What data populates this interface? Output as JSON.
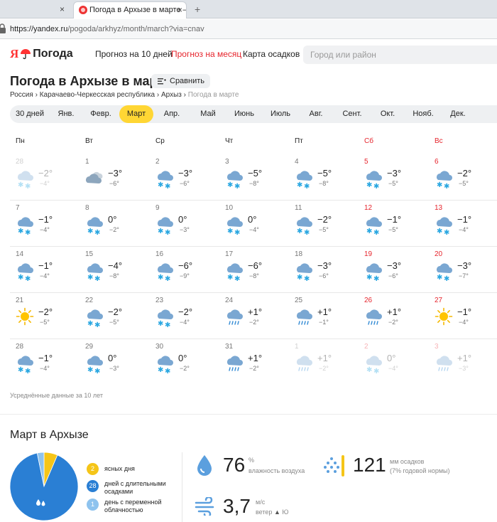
{
  "browser": {
    "tab_inactive_label": "",
    "tab_active_label": "Погода в Архызе в марте — Янд",
    "close_glyph": "×",
    "newtab_glyph": "+",
    "url_host": "https://yandex.ru",
    "url_path": "/pogoda/arkhyz/month/march?via=cnav"
  },
  "header": {
    "logo_ya": "Я",
    "logo_brand": "Погода",
    "nav": [
      "Прогноз на 10 дней",
      "Прогноз на месяц",
      "Карта осадков"
    ],
    "search_placeholder": "Город или район"
  },
  "page": {
    "title": "Погода в Архызе в марте",
    "compare_label": "Сравнить",
    "breadcrumbs": [
      "Россия",
      "Карачаево-Черкесская республика",
      "Архыз",
      "Погода в марте"
    ],
    "crumb_sep": " › "
  },
  "months": [
    "30 дней",
    "Янв.",
    "Февр.",
    "Март",
    "Апр.",
    "Май",
    "Июнь",
    "Июль",
    "Авг.",
    "Сент.",
    "Окт.",
    "Нояб.",
    "Дек."
  ],
  "active_month": 3,
  "weekdays": [
    "Пн",
    "Вт",
    "Ср",
    "Чт",
    "Пт",
    "Сб",
    "Вс"
  ],
  "calendar": [
    [
      {
        "day": "28",
        "icon": "snow",
        "tmax": "−2°",
        "tmin": "−4°",
        "faded": true
      },
      {
        "day": "1",
        "icon": "cloudy",
        "tmax": "−3°",
        "tmin": "−6°"
      },
      {
        "day": "2",
        "icon": "snow",
        "tmax": "−3°",
        "tmin": "−6°"
      },
      {
        "day": "3",
        "icon": "snow",
        "tmax": "−5°",
        "tmin": "−8°"
      },
      {
        "day": "4",
        "icon": "snow",
        "tmax": "−5°",
        "tmin": "−8°"
      },
      {
        "day": "5",
        "icon": "snow",
        "tmax": "−3°",
        "tmin": "−5°"
      },
      {
        "day": "6",
        "icon": "snow",
        "tmax": "−2°",
        "tmin": "−5°"
      }
    ],
    [
      {
        "day": "7",
        "icon": "snow",
        "tmax": "−1°",
        "tmin": "−4°"
      },
      {
        "day": "8",
        "icon": "snow",
        "tmax": "0°",
        "tmin": "−2°"
      },
      {
        "day": "9",
        "icon": "snow",
        "tmax": "0°",
        "tmin": "−3°"
      },
      {
        "day": "10",
        "icon": "snow",
        "tmax": "0°",
        "tmin": "−4°"
      },
      {
        "day": "11",
        "icon": "snow",
        "tmax": "−2°",
        "tmin": "−5°"
      },
      {
        "day": "12",
        "icon": "snow",
        "tmax": "−1°",
        "tmin": "−5°"
      },
      {
        "day": "13",
        "icon": "snow",
        "tmax": "−1°",
        "tmin": "−4°"
      }
    ],
    [
      {
        "day": "14",
        "icon": "snow",
        "tmax": "−1°",
        "tmin": "−4°"
      },
      {
        "day": "15",
        "icon": "snow",
        "tmax": "−4°",
        "tmin": "−8°"
      },
      {
        "day": "16",
        "icon": "snow",
        "tmax": "−6°",
        "tmin": "−9°"
      },
      {
        "day": "17",
        "icon": "snow",
        "tmax": "−6°",
        "tmin": "−8°"
      },
      {
        "day": "18",
        "icon": "snow",
        "tmax": "−3°",
        "tmin": "−6°"
      },
      {
        "day": "19",
        "icon": "snow",
        "tmax": "−3°",
        "tmin": "−6°"
      },
      {
        "day": "20",
        "icon": "snow",
        "tmax": "−3°",
        "tmin": "−7°"
      }
    ],
    [
      {
        "day": "21",
        "icon": "sun",
        "tmax": "−2°",
        "tmin": "−5°"
      },
      {
        "day": "22",
        "icon": "snow",
        "tmax": "−2°",
        "tmin": "−5°"
      },
      {
        "day": "23",
        "icon": "snow",
        "tmax": "−2°",
        "tmin": "−4°"
      },
      {
        "day": "24",
        "icon": "rain",
        "tmax": "+1°",
        "tmin": "−2°"
      },
      {
        "day": "25",
        "icon": "rain",
        "tmax": "+1°",
        "tmin": "−1°"
      },
      {
        "day": "26",
        "icon": "rain",
        "tmax": "+1°",
        "tmin": "−2°"
      },
      {
        "day": "27",
        "icon": "sun",
        "tmax": "−1°",
        "tmin": "−4°"
      }
    ],
    [
      {
        "day": "28",
        "icon": "snow",
        "tmax": "−1°",
        "tmin": "−4°"
      },
      {
        "day": "29",
        "icon": "snow",
        "tmax": "0°",
        "tmin": "−3°"
      },
      {
        "day": "30",
        "icon": "snow",
        "tmax": "0°",
        "tmin": "−2°"
      },
      {
        "day": "31",
        "icon": "rain",
        "tmax": "+1°",
        "tmin": "−2°"
      },
      {
        "day": "1",
        "icon": "rain",
        "tmax": "+1°",
        "tmin": "−2°",
        "faded": true
      },
      {
        "day": "2",
        "icon": "snow",
        "tmax": "0°",
        "tmin": "−4°",
        "faded": true
      },
      {
        "day": "3",
        "icon": "rain",
        "tmax": "+1°",
        "tmin": "−3°",
        "faded": true
      }
    ]
  ],
  "avg_note": "Усреднённые данные за 10 лет",
  "summary": {
    "title": "Март в Архызе",
    "legend": [
      {
        "count": "2",
        "label": "ясных дня",
        "color": "#f5c518"
      },
      {
        "count": "28",
        "label": "дней с длительными осадками",
        "color": "#2a7fd4"
      },
      {
        "count": "1",
        "label": "день с переменной облачностью",
        "color": "#8ec3ee"
      }
    ],
    "pie_values": [
      2,
      28,
      1
    ],
    "humidity": {
      "value": "76",
      "unit": "%",
      "label": "влажность воздуха"
    },
    "precip": {
      "value": "121",
      "unit": "мм осадков",
      "label": "(7% годовой нормы)"
    },
    "wind": {
      "value": "3,7",
      "unit": "м/с",
      "label": "ветер",
      "dir": "Ю"
    }
  },
  "colors": {
    "accent": "#ffd634",
    "red": "#e6252d",
    "blue": "#2a7fd4"
  }
}
